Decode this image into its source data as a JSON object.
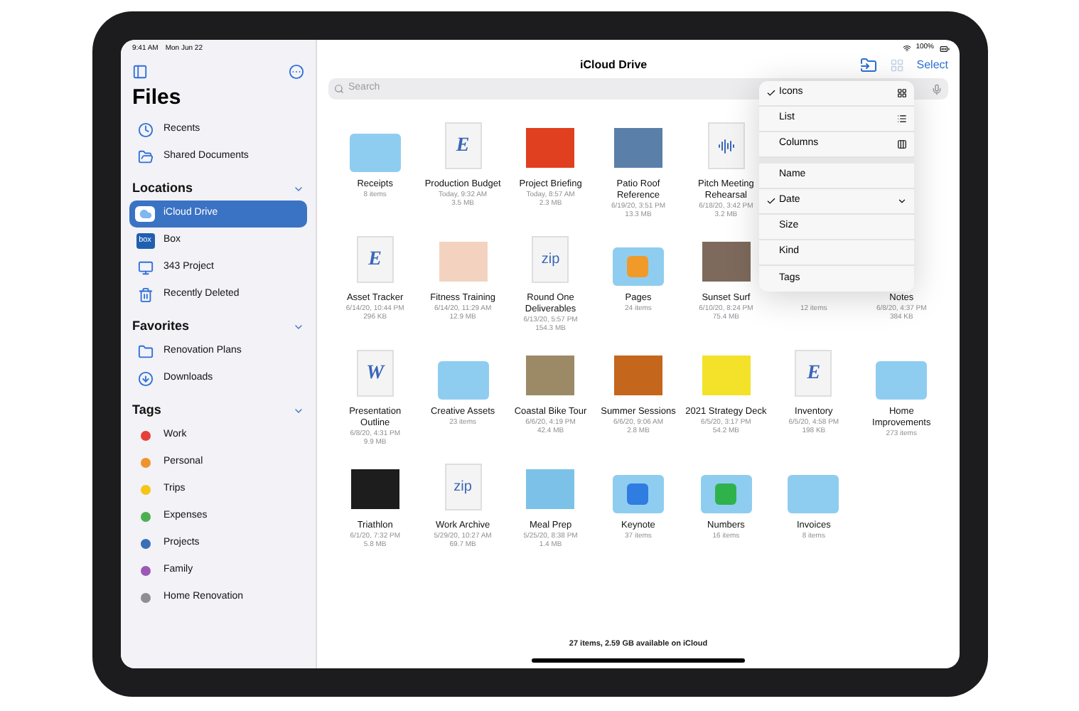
{
  "status_bar": {
    "time": "9:41 AM",
    "date": "Mon Jun 22",
    "battery": "100%"
  },
  "sidebar": {
    "title": "Files",
    "items": [
      {
        "label": "Recents",
        "kind": "clock"
      },
      {
        "label": "Shared Documents",
        "kind": "shared"
      }
    ],
    "sections": [
      {
        "title": "Locations",
        "expanded": true,
        "items": [
          {
            "label": "iCloud Drive",
            "kind": "cloud",
            "selected": true
          },
          {
            "label": "Box",
            "kind": "badge",
            "badge": "box",
            "selected": false
          },
          {
            "label": "343 Project",
            "kind": "monitor",
            "selected": false
          },
          {
            "label": "Recently Deleted",
            "kind": "trash",
            "selected": false
          }
        ]
      },
      {
        "title": "Favorites",
        "expanded": true,
        "items": [
          {
            "label": "Renovation Plans",
            "kind": "folder",
            "selected": false
          },
          {
            "label": "Downloads",
            "kind": "download",
            "selected": false
          }
        ]
      },
      {
        "title": "Tags",
        "expanded": true,
        "items": [
          {
            "label": "Work",
            "kind": "tag",
            "color": "#e5403a",
            "selected": false
          },
          {
            "label": "Personal",
            "kind": "tag",
            "color": "#f0932b",
            "selected": false
          },
          {
            "label": "Trips",
            "kind": "tag",
            "color": "#f5c518",
            "selected": false
          },
          {
            "label": "Expenses",
            "kind": "tag",
            "color": "#4caf50",
            "selected": false
          },
          {
            "label": "Projects",
            "kind": "tag",
            "color": "#3a6fb5",
            "selected": false
          },
          {
            "label": "Family",
            "kind": "tag",
            "color": "#9b59b6",
            "selected": false
          },
          {
            "label": "Home Renovation",
            "kind": "tag",
            "color": "#8e8e93",
            "selected": false
          }
        ]
      }
    ]
  },
  "toolbar": {
    "title": "iCloud Drive",
    "select": "Select"
  },
  "search": {
    "placeholder": "Search"
  },
  "files": [
    {
      "kind": "folder",
      "name": "Receipts",
      "details": [
        "8 items"
      ]
    },
    {
      "kind": "document",
      "glyph": "E",
      "name": "Production Budget",
      "details": [
        "Today, 9:32 AM",
        "3.5 MB"
      ]
    },
    {
      "kind": "image",
      "color": "#e0401f",
      "name": "Project Briefing",
      "details": [
        "Today, 8:57 AM",
        "2.3 MB"
      ]
    },
    {
      "kind": "image",
      "color": "#5a7fa8",
      "name": "Patio Roof Reference",
      "details": [
        "6/19/20, 3:51 PM",
        "13.3 MB"
      ]
    },
    {
      "kind": "document",
      "name": "Pitch Meeting Rehearsal",
      "details": [
        "6/18/20, 3:42 PM",
        "3.2 MB"
      ]
    },
    {
      "kind": "hidden"
    },
    {
      "kind": "hidden"
    },
    {
      "kind": "document",
      "glyph": "E",
      "name": "Asset Tracker",
      "details": [
        "6/14/20, 10:44 PM",
        "296 KB"
      ]
    },
    {
      "kind": "image",
      "color": "#f3d3bf",
      "name": "Fitness Training",
      "details": [
        "6/14/20, 11:29 AM",
        "12.9 MB"
      ]
    },
    {
      "kind": "document",
      "glyph": "zip",
      "name": "Round One Deliverables",
      "details": [
        "6/13/20, 5:57 PM",
        "154.3 MB"
      ]
    },
    {
      "kind": "app-folder",
      "color": "#f09a2a",
      "name": "Pages",
      "details": [
        "24 items"
      ]
    },
    {
      "kind": "image",
      "color": "#7d6a5c",
      "name": "Sunset Surf",
      "details": [
        "6/10/20, 8:24 PM",
        "75.4 MB"
      ]
    },
    {
      "kind": "covered",
      "details": [
        "12 items"
      ]
    },
    {
      "kind": "covered",
      "name": "Notes",
      "details": [
        "6/8/20, 4:37 PM",
        "384 KB"
      ]
    },
    {
      "kind": "document",
      "glyph": "W",
      "name": "Presentation Outline",
      "details": [
        "6/8/20, 4:31 PM",
        "9.9 MB"
      ]
    },
    {
      "kind": "folder",
      "name": "Creative Assets",
      "details": [
        "23 items"
      ]
    },
    {
      "kind": "image",
      "color": "#9c8a66",
      "name": "Coastal Bike Tour",
      "details": [
        "6/6/20, 4:19 PM",
        "42.4 MB"
      ]
    },
    {
      "kind": "image",
      "color": "#c4661c",
      "name": "Summer Sessions",
      "details": [
        "6/6/20, 9:06 AM",
        "2.8 MB"
      ]
    },
    {
      "kind": "image",
      "color": "#f4e22a",
      "name": "2021 Strategy Deck",
      "details": [
        "6/5/20, 3:17 PM",
        "54.2 MB"
      ]
    },
    {
      "kind": "document",
      "glyph": "E",
      "name": "Inventory",
      "details": [
        "6/5/20, 4:58 PM",
        "198 KB"
      ]
    },
    {
      "kind": "folder",
      "name": "Home Improvements",
      "details": [
        "273 items"
      ]
    },
    {
      "kind": "image",
      "color": "#1d1d1d",
      "name": "Triathlon",
      "details": [
        "6/1/20, 7:32 PM",
        "5.8 MB"
      ]
    },
    {
      "kind": "document",
      "glyph": "zip",
      "name": "Work Archive",
      "details": [
        "5/29/20, 10:27 AM",
        "69.7 MB"
      ]
    },
    {
      "kind": "image",
      "color": "#7cc2e8",
      "name": "Meal Prep",
      "details": [
        "5/25/20, 8:38 PM",
        "1.4 MB"
      ]
    },
    {
      "kind": "app-folder",
      "color": "#2f7de1",
      "name": "Keynote",
      "details": [
        "37 items"
      ]
    },
    {
      "kind": "app-folder",
      "color": "#2fb24c",
      "name": "Numbers",
      "details": [
        "16 items"
      ]
    },
    {
      "kind": "folder",
      "name": "Invoices",
      "details": [
        "8 items"
      ]
    }
  ],
  "menu": {
    "views": [
      {
        "label": "Icons",
        "kind": "grid",
        "selected": true
      },
      {
        "label": "List",
        "kind": "list",
        "selected": false
      },
      {
        "label": "Columns",
        "kind": "columns",
        "selected": false
      }
    ],
    "sort": [
      {
        "label": "Name",
        "selected": false
      },
      {
        "label": "Date",
        "selected": true
      },
      {
        "label": "Size",
        "selected": false
      },
      {
        "label": "Kind",
        "selected": false
      },
      {
        "label": "Tags",
        "selected": false
      }
    ]
  },
  "footer": "27 items, 2.59 GB available on iCloud"
}
